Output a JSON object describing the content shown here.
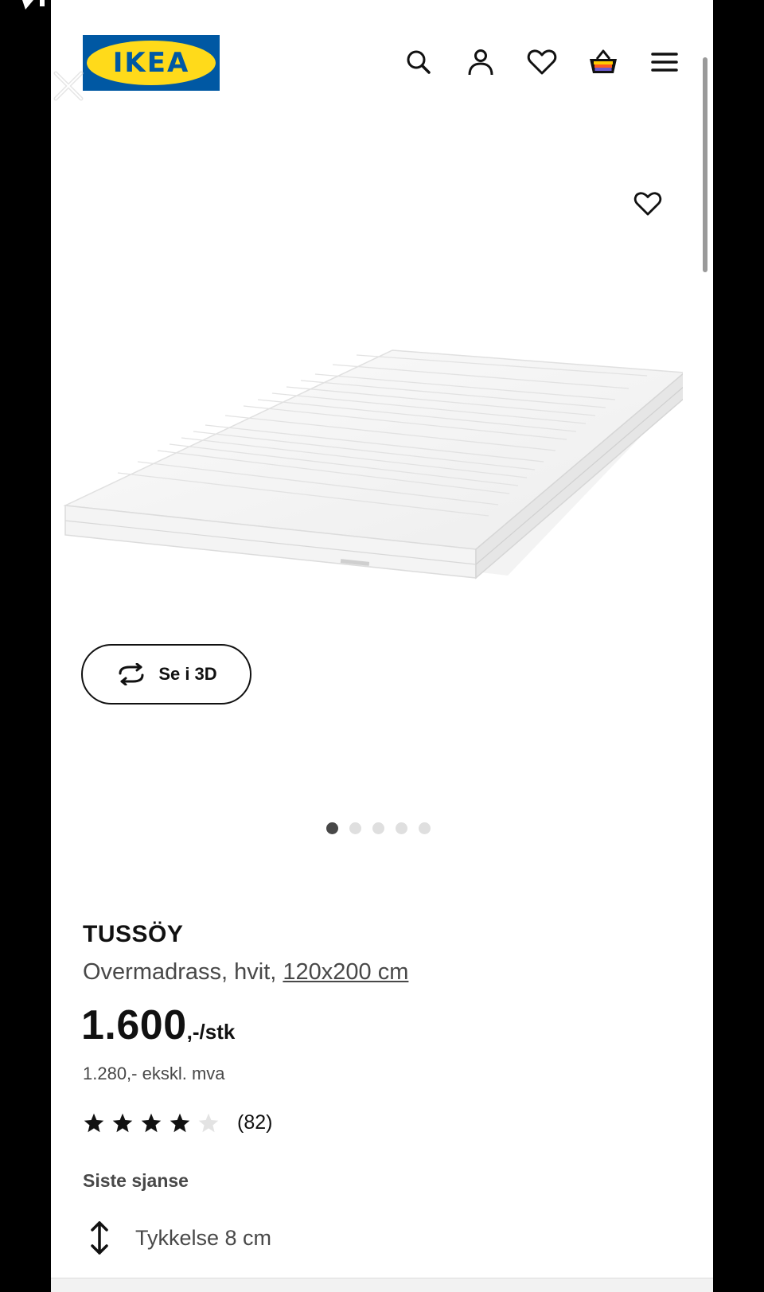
{
  "logo": {
    "text": "IKEA"
  },
  "header": {
    "icons": [
      "search-icon",
      "user-icon",
      "heart-icon",
      "cart-icon",
      "menu-icon"
    ]
  },
  "gallery": {
    "button_3d_label": "Se i 3D",
    "total_images": 5,
    "active_index": 0
  },
  "product": {
    "name": "TUSSÖY",
    "description": "Overmadrass, hvit, ",
    "size": "120x200 cm",
    "price": "1.600",
    "price_suffix": ",-/stk",
    "price_ex_vat": "1.280,- ekskl. mva",
    "rating": 4,
    "rating_max": 5,
    "rating_count": "(82)",
    "status": "Siste sjanse",
    "spec": "Tykkelse 8 cm"
  },
  "colors": {
    "ikea_blue": "#0058a3",
    "ikea_yellow": "#ffda1a",
    "text_primary": "#111111",
    "text_secondary": "#484848"
  }
}
